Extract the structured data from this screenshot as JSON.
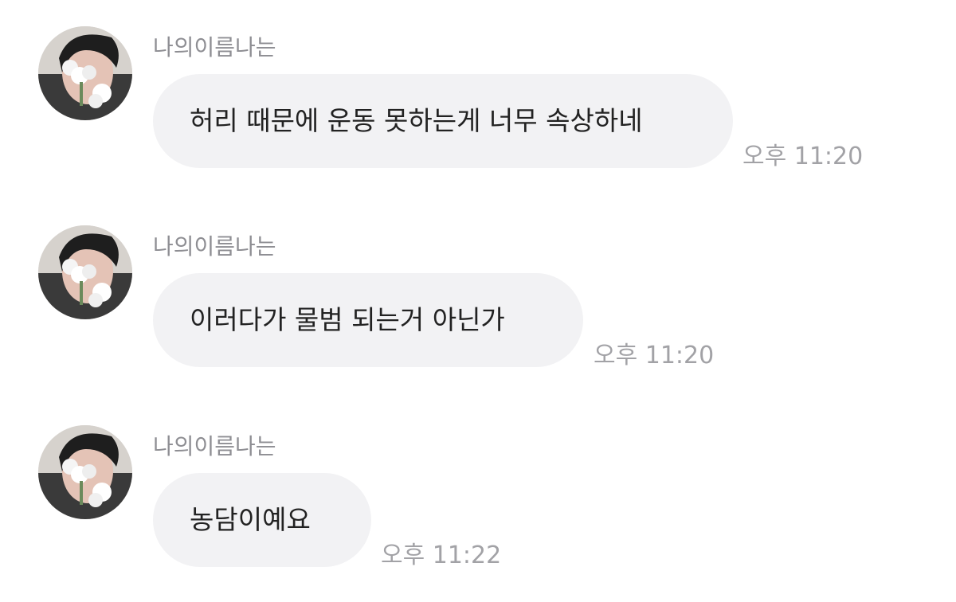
{
  "messages": [
    {
      "sender": "나의이름나는",
      "text": "허리 때문에 운동 못하는게 너무 속상하네",
      "time": "오후 11:20"
    },
    {
      "sender": "나의이름나는",
      "text": "이러다가 물범 되는거 아닌가",
      "time": "오후 11:20"
    },
    {
      "sender": "나의이름나는",
      "text": "농담이예요",
      "time": "오후 11:22"
    }
  ],
  "colors": {
    "background": "#ffffff",
    "bubble": "#f2f2f4",
    "message_text": "#222222",
    "sender_name": "#8e8e93",
    "timestamp": "#a2a2a6"
  },
  "icons": {
    "avatar": "profile-photo"
  }
}
